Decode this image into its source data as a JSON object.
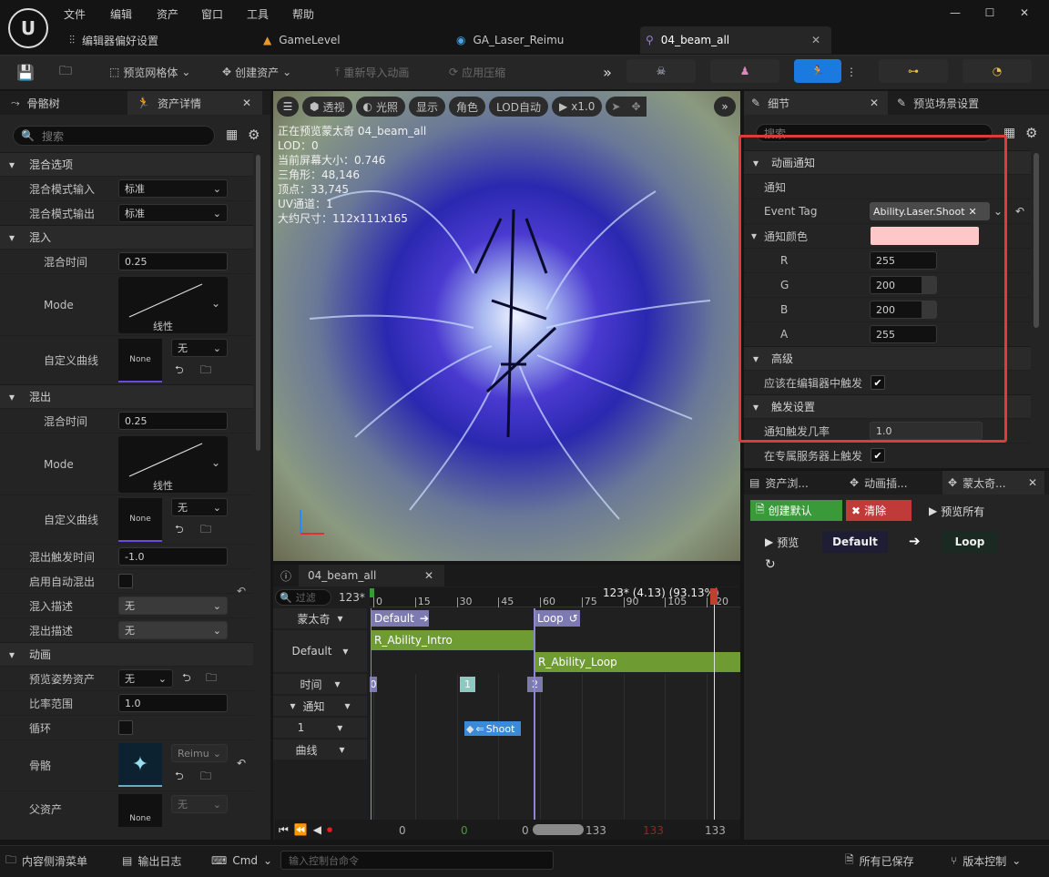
{
  "title_bar": {
    "menus": [
      "文件",
      "编辑",
      "资产",
      "窗口",
      "工具",
      "帮助"
    ],
    "tabs": [
      "编辑器偏好设置",
      "GameLevel",
      "GA_Laser_Reimu",
      "04_beam_all"
    ]
  },
  "toolbar": {
    "preview_mesh": "预览网格体",
    "create_asset": "创建资产",
    "reimport": "重新导入动画",
    "apply_compression": "应用压缩"
  },
  "left_panel": {
    "tab_skeleton": "骨骼树",
    "tab_asset_details": "资产详情",
    "search_placeholder": "搜索",
    "sec_blend_options": "混合选项",
    "blend_mode_in": "混合模式输入",
    "blend_mode_in_value": "标准",
    "blend_mode_out": "混合模式输出",
    "blend_mode_out_value": "标准",
    "sec_blend_in": "混入",
    "blend_time": "混合时间",
    "blend_time_in_value": "0.25",
    "mode": "Mode",
    "linear": "线性",
    "custom_curve": "自定义曲线",
    "none_button": "None",
    "none": "无",
    "sec_blend_out": "混出",
    "blend_time_out_value": "0.25",
    "blend_out_trigger_time": "混出触发时间",
    "blend_out_trigger_value": "-1.0",
    "enable_auto_blend_out": "启用自动混出",
    "blend_in_desc": "混入描述",
    "blend_out_desc": "混出描述",
    "sec_animation": "动画",
    "preview_pose_asset": "预览姿势资产",
    "rate_scale": "比率范围",
    "rate_scale_value": "1.0",
    "loop": "循环",
    "skeleton": "骨骼",
    "skeleton_value": "Reimu",
    "parent_asset": "父资产"
  },
  "viewport": {
    "perspective": "透视",
    "lit": "光照",
    "show": "显示",
    "character": "角色",
    "lod_auto": "LOD自动",
    "speed": "x1.0",
    "stats": [
      "正在预览蒙太奇 04_beam_all",
      "LOD：0",
      "当前屏幕大小：0.746",
      "三角形：48,146",
      "顶点：33,745",
      "UV通道：1",
      "大约尺寸：112x111x165"
    ]
  },
  "timeline": {
    "tab": "04_beam_all",
    "filter_placeholder": "过滤",
    "frame_count": "123*",
    "cursor_info": "123* (4.13) (93.13%)",
    "ticks": [
      "0",
      "15",
      "30",
      "45",
      "60",
      "75",
      "90",
      "105",
      "120"
    ],
    "tracks": {
      "montage": "蒙太奇",
      "default_slot": "Default",
      "time": "时间",
      "notify": "通知",
      "notify_index": "1",
      "curves": "曲线"
    },
    "sections": [
      "Default",
      "Loop"
    ],
    "segments": [
      "R_Ability_Intro",
      "R_Ability_Loop"
    ],
    "markers": [
      "0",
      "1",
      "2"
    ],
    "notify_label": "Shoot",
    "transport_values": [
      "0",
      "0",
      "0",
      "133",
      "133",
      "133"
    ]
  },
  "details": {
    "tab_details": "细节",
    "tab_preview_settings": "预览场景设置",
    "search_placeholder": "搜索",
    "sec_anim_notify": "动画通知",
    "notify": "通知",
    "event_tag": "Event Tag",
    "event_tag_value": "Ability.Laser.Shoot",
    "sec_notify_color": "通知颜色",
    "r": "R",
    "g": "G",
    "b": "B",
    "a": "A",
    "r_value": "255",
    "g_value": "200",
    "b_value": "200",
    "a_value": "255",
    "notify_color_hex": "#ffc8c8",
    "sec_advanced": "高级",
    "should_fire_in_editor": "应该在编辑器中触发",
    "sec_trigger_settings": "触发设置",
    "notify_trigger_chance": "通知触发几率",
    "notify_trigger_chance_value": "1.0",
    "trigger_on_dedicated_server": "在专属服务器上触发"
  },
  "bottom_tabs": {
    "asset_browser": "资产浏...",
    "anim_slots": "动画插...",
    "montage_sections": "蒙太奇...",
    "create_default": "创建默认",
    "clear": "清除",
    "preview_all": "预览所有",
    "preview": "预览",
    "default": "Default",
    "loop": "Loop"
  },
  "status_bar": {
    "content_drawer": "内容侧滑菜单",
    "output_log": "输出日志",
    "cmd": "Cmd",
    "console_placeholder": "输入控制台命令",
    "all_saved": "所有已保存",
    "source_control": "版本控制"
  }
}
